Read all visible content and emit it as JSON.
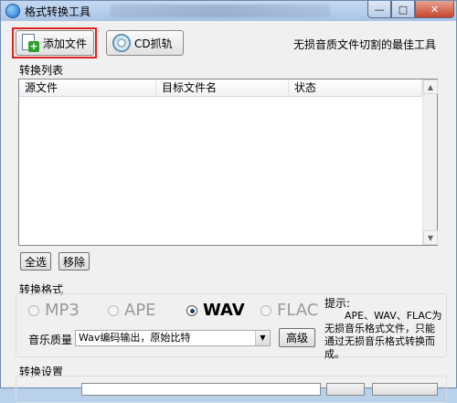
{
  "window": {
    "title": "格式转换工具",
    "controls": {
      "minimize": "—",
      "maximize": "□",
      "close": "✕"
    }
  },
  "toolbar": {
    "add_file_label": "添加文件",
    "cd_rip_label": "CD抓轨",
    "slogan": "无损音质文件切割的最佳工具"
  },
  "convert_list": {
    "group_label": "转换列表",
    "columns": [
      "源文件",
      "目标文件名",
      "状态"
    ],
    "rows": [],
    "select_all_label": "全选",
    "remove_label": "移除"
  },
  "convert_format": {
    "group_label": "转换格式",
    "options": [
      "MP3",
      "APE",
      "WAV",
      "FLAC"
    ],
    "selected": "WAV",
    "quality_label": "音乐质量",
    "quality_value": "Wav编码输出，原始比特",
    "advanced_label": "高级",
    "hint_title": "提示:",
    "hint_body": "APE、WAV、FLAC为无损音乐格式文件，只能通过无损音乐格式转换而成。"
  },
  "settings": {
    "group_label": "转换设置"
  },
  "colors": {
    "highlight": "#e02020",
    "titlebar": "#b9d1ea"
  }
}
